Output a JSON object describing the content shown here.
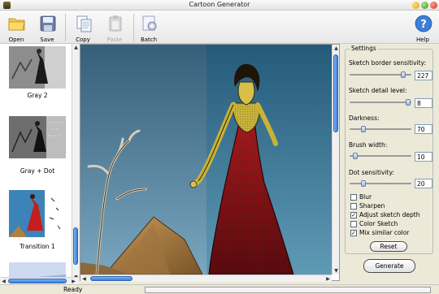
{
  "window": {
    "title": "Cartoon Generator"
  },
  "toolbar": {
    "open": "Open",
    "save": "Save",
    "copy": "Copy",
    "paste": "Paste",
    "batch": "Batch",
    "help": "Help"
  },
  "thumbnails": [
    {
      "label": "Gray 2"
    },
    {
      "label": "Gray + Dot"
    },
    {
      "label": "Transition 1"
    }
  ],
  "settings": {
    "title": "Settings",
    "sliders": [
      {
        "label": "Sketch border sensitivity:",
        "value": "227",
        "level": 0.9
      },
      {
        "label": "Sketch detail level:",
        "value": "8",
        "level": 0.98
      },
      {
        "label": "Darkness:",
        "value": "70",
        "level": 0.2
      },
      {
        "label": "Brush width:",
        "value": "10",
        "level": 0.06
      },
      {
        "label": "Dot sensitivity:",
        "value": "20",
        "level": 0.2
      }
    ],
    "checkboxes": [
      {
        "label": "Blur",
        "checked": false
      },
      {
        "label": "Sharpen",
        "checked": false
      },
      {
        "label": "Adjust sketch depth",
        "checked": true
      },
      {
        "label": "Color Sketch",
        "checked": false
      },
      {
        "label": "Mix similar color",
        "checked": true
      }
    ],
    "reset": "Reset"
  },
  "generate": "Generate",
  "status": {
    "text": "Ready"
  },
  "colors": {
    "accent": "#3a7fd8",
    "sky_left": "#3f6f8d",
    "sky_right": "#2c6788",
    "dress": "#8c1418"
  }
}
